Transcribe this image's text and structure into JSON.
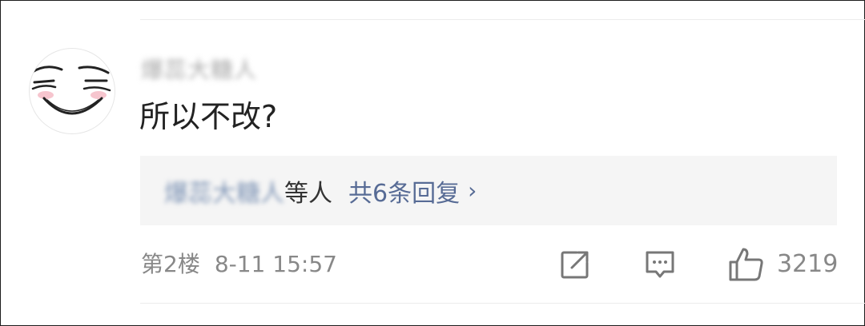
{
  "comment": {
    "username": "爆蕊大糖人",
    "avatar_icon": "smiling-face-meme-icon",
    "text": "所以不改?"
  },
  "replies": {
    "names": "爆蕊大糖人",
    "suffix": "等人",
    "count_label": "共6条回复",
    "chevron": "›"
  },
  "meta": {
    "floor": "第2楼",
    "timestamp": "8-11 15:57"
  },
  "actions": {
    "share_icon": "share-icon",
    "comment_icon": "comment-icon",
    "like_icon": "thumbs-up-icon",
    "like_count": "3219"
  },
  "colors": {
    "link_blue": "#576b95",
    "reply_bg": "#f5f5f5",
    "meta_gray": "#888888"
  }
}
